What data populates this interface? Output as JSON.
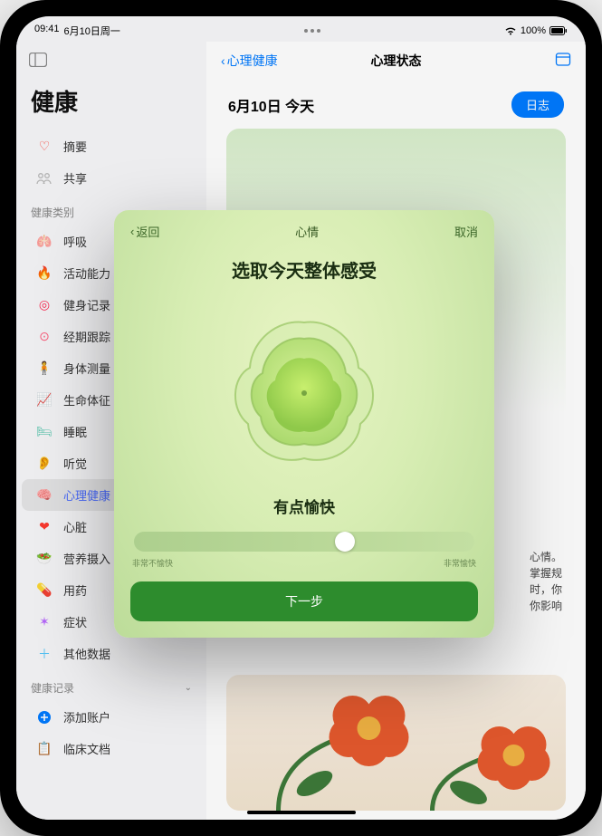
{
  "status": {
    "time": "09:41",
    "date": "6月10日周一",
    "battery_text": "100%"
  },
  "sidebar": {
    "title": "健康",
    "summary": "摘要",
    "sharing": "共享",
    "categories_header": "健康类别",
    "items": {
      "respiratory": "呼吸",
      "activity": "活动能力",
      "fitness": "健身记录",
      "cycle": "经期跟踪",
      "body": "身体测量",
      "vitals": "生命体征",
      "sleep": "睡眠",
      "hearing": "听觉",
      "mental": "心理健康",
      "heart": "心脏",
      "nutrition": "营养摄入",
      "medications": "用药",
      "symptoms": "症状",
      "other": "其他数据"
    },
    "records_header": "健康记录",
    "add_account": "添加账户",
    "clinical_docs": "临床文档"
  },
  "main": {
    "back_label": "心理健康",
    "title": "心理状态",
    "date": "6月10日 今天",
    "log_button": "日志",
    "info_lines": [
      "心情。",
      "掌握规",
      "时，你",
      "你影响"
    ]
  },
  "modal": {
    "back": "返回",
    "title": "心情",
    "cancel": "取消",
    "prompt": "选取今天整体感受",
    "mood": "有点愉快",
    "slider_min": "非常不愉快",
    "slider_max": "非常愉快",
    "next": "下一步"
  }
}
